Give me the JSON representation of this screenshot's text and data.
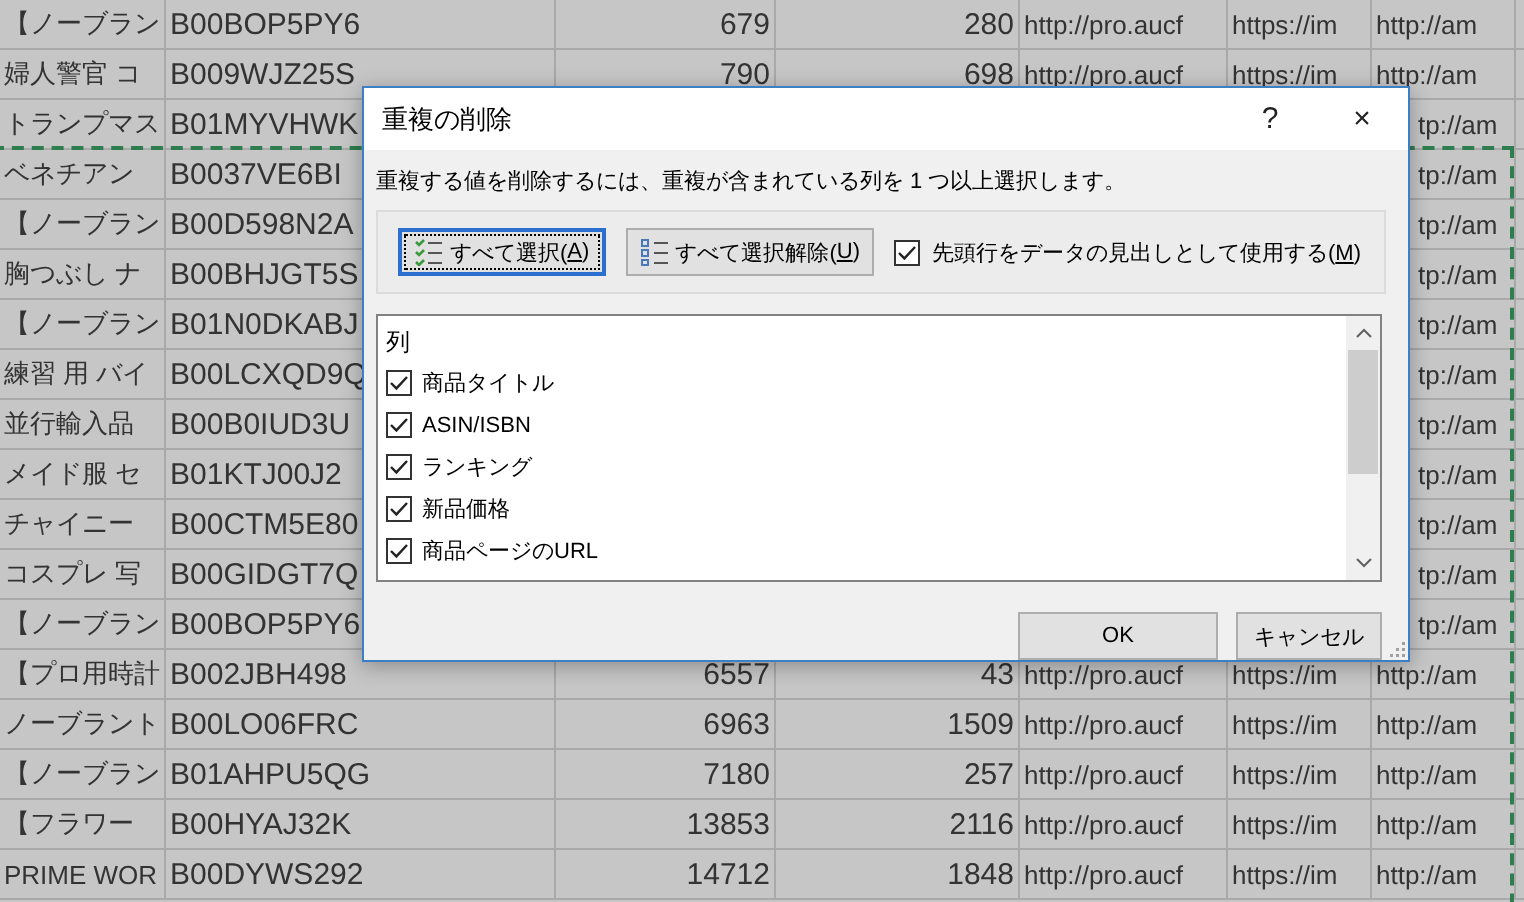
{
  "sheet": {
    "rows": [
      {
        "column_1": "【ノーブラン",
        "column_2": "B00BOP5PY6",
        "column_3": "679",
        "column_4": "280",
        "column_5": "http://pro.aucf",
        "column_6": "https://im",
        "column_7": "http://am"
      },
      {
        "column_1": "婦人警官 コ",
        "column_2": "B009WJZ25S",
        "column_3": "790",
        "column_4": "698",
        "column_5": "http://pro.aucf",
        "column_6": "https://im",
        "column_7": "http://am"
      },
      {
        "column_1": "トランプマス",
        "column_2": "B01MYVHWK",
        "column_7": "tp://am"
      },
      {
        "column_1": "ベネチアン",
        "column_2": "B0037VE6BI",
        "column_7": "tp://am"
      },
      {
        "column_1": "【ノーブラン",
        "column_2": "B00D598N2A",
        "column_7": "tp://am"
      },
      {
        "column_1": "胸つぶし ナ",
        "column_2": "B00BHJGT5S",
        "column_7": "tp://am"
      },
      {
        "column_1": "【ノーブラン",
        "column_2": "B01N0DKABJ",
        "column_7": "tp://am"
      },
      {
        "column_1": "練習 用 バイ",
        "column_2": "B00LCXQD9Q",
        "column_7": "tp://am"
      },
      {
        "column_1": "並行輸入品",
        "column_2": "B00B0IUD3U",
        "column_7": "tp://am"
      },
      {
        "column_1": "メイド服 セ",
        "column_2": "B01KTJ00J2",
        "column_7": "tp://am"
      },
      {
        "column_1": "チャイニー",
        "column_2": "B00CTM5E80",
        "column_7": "tp://am"
      },
      {
        "column_1": "コスプレ 写",
        "column_2": "B00GIDGT7Q",
        "column_7": "tp://am"
      },
      {
        "column_1": "【ノーブラン",
        "column_2": "B00BOP5PY6",
        "column_7": "tp://am"
      },
      {
        "column_1": "【プロ用時計",
        "column_2": "B002JBH498",
        "column_3": "6557",
        "column_4": "43",
        "column_5": "http://pro.aucf",
        "column_6": "https://im",
        "column_7": "http://am"
      },
      {
        "column_1": "ノーブラント",
        "column_2": "B00LO06FRC",
        "column_3": "6963",
        "column_4": "1509",
        "column_5": "http://pro.aucf",
        "column_6": "https://im",
        "column_7": "http://am"
      },
      {
        "column_1": "【ノーブラン",
        "column_2": "B01AHPU5QG",
        "column_3": "7180",
        "column_4": "257",
        "column_5": "http://pro.aucf",
        "column_6": "https://im",
        "column_7": "http://am"
      },
      {
        "column_1": "【フラワー",
        "column_2": "B00HYAJ32K",
        "column_3": "13853",
        "column_4": "2116",
        "column_5": "http://pro.aucf",
        "column_6": "https://im",
        "column_7": "http://am"
      },
      {
        "column_1": "PRIME WOR",
        "column_2": "B00DYWS292",
        "column_3": "14712",
        "column_4": "1848",
        "column_5": "http://pro.aucf",
        "column_6": "https://im",
        "column_7": "http://am"
      }
    ]
  },
  "dialog": {
    "title": "重複の削除",
    "help": "?",
    "close": "×",
    "instruction": "重複する値を削除するには、重複が含まれている列を 1 つ以上選択します。",
    "select_all": {
      "before": "すべて選択(",
      "key": "A",
      "after": ")",
      "focused": true
    },
    "unselect_all": {
      "before": "すべて選択解除(",
      "key": "U",
      "after": ")",
      "focused": false
    },
    "header_option": {
      "before": "先頭行をデータの見出しとして使用する(",
      "key": "M",
      "after": ")",
      "checked": true
    },
    "list_header": "列",
    "columns": [
      {
        "label": "商品タイトル",
        "checked": true
      },
      {
        "label": "ASIN/ISBN",
        "checked": true
      },
      {
        "label": "ランキング",
        "checked": true
      },
      {
        "label": "新品価格",
        "checked": true
      },
      {
        "label": "商品ページのURL",
        "checked": true
      }
    ],
    "ok": "OK",
    "cancel": "キャンセル"
  }
}
